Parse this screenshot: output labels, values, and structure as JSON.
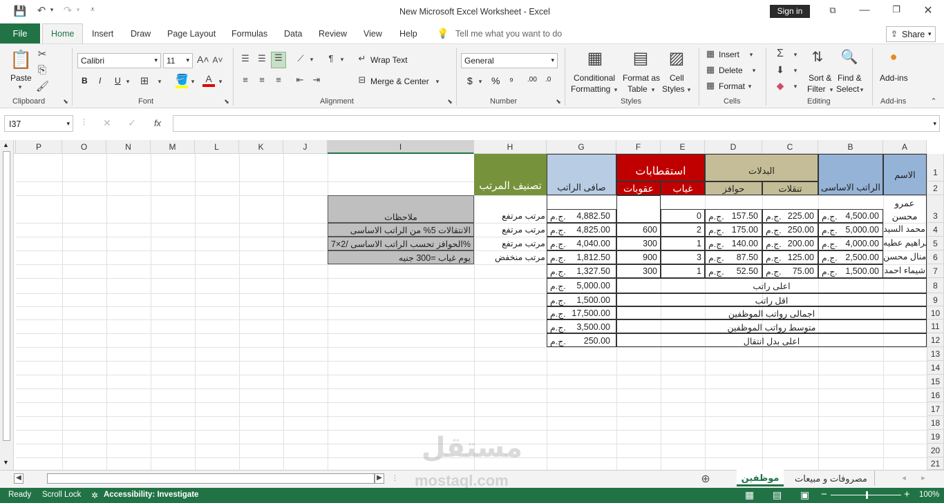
{
  "window": {
    "title": "New Microsoft Excel Worksheet  -  Excel",
    "sign_in": "Sign in"
  },
  "tabs": [
    "File",
    "Home",
    "Insert",
    "Draw",
    "Page Layout",
    "Formulas",
    "Data",
    "Review",
    "View",
    "Help"
  ],
  "tell_me": "Tell me what you want to do",
  "share": "Share",
  "ribbon": {
    "clipboard": {
      "label": "Clipboard",
      "paste": "Paste"
    },
    "font": {
      "label": "Font",
      "name": "Calibri",
      "size": "11",
      "bold": "B",
      "italic": "I",
      "underline": "U"
    },
    "alignment": {
      "label": "Alignment",
      "wrap": "Wrap Text",
      "merge": "Merge & Center"
    },
    "number": {
      "label": "Number",
      "format": "General",
      "currency": "$",
      "percent": "%",
      "comma": "⁹",
      "inc_decimal": ".00",
      "dec_decimal": ".0"
    },
    "styles": {
      "label": "Styles",
      "conditional_1": "Conditional",
      "conditional_2": "Formatting",
      "format_table_1": "Format as",
      "format_table_2": "Table",
      "cell_styles_1": "Cell",
      "cell_styles_2": "Styles"
    },
    "cells": {
      "label": "Cells",
      "insert": "Insert",
      "delete": "Delete",
      "format": "Format"
    },
    "editing": {
      "label": "Editing",
      "sort_1": "Sort &",
      "sort_2": "Filter",
      "find_1": "Find &",
      "find_2": "Select"
    },
    "addins": {
      "label": "Add-ins",
      "addins": "Add-ins"
    }
  },
  "formula_bar": {
    "name_box": "I37",
    "fx": "fx",
    "value": ""
  },
  "columns": [
    "P",
    "O",
    "N",
    "M",
    "L",
    "K",
    "J",
    "I",
    "H",
    "G",
    "F",
    "E",
    "D",
    "C",
    "B",
    "A"
  ],
  "rows": [
    "1",
    "2",
    "3",
    "4",
    "5",
    "6",
    "7",
    "8",
    "9",
    "10",
    "11",
    "12",
    "13",
    "14",
    "15",
    "16",
    "17",
    "18",
    "19",
    "20",
    "21"
  ],
  "sheet": {
    "name_header": "الاسم",
    "basic_salary": "الراتب الاساسى",
    "allowances": "البدلات",
    "transport": "تنقلات",
    "incentives": "حوافز",
    "deductions": "استقطابات",
    "absence": "غياب",
    "penalties": "عقوبات",
    "net_salary": "صافى الراتب",
    "salary_class": "تصنيف المرتب",
    "notes": "ملاحظات",
    "note_1": "الانتقالات 5% من الراتب الاساسى",
    "note_2": "الحوافز تحسب الراتب الاساسى /2×7%",
    "note_3": "يوم غياب =300 جنيه",
    "employees": [
      {
        "name": "عمرو محسن",
        "basic": "4,500.00",
        "transport": "225.00",
        "incentives": "157.50",
        "absence": "0",
        "penalty": "",
        "net": "4,882.50",
        "class": "مرتب مرتفع"
      },
      {
        "name": "محمد السيد",
        "basic": "5,000.00",
        "transport": "250.00",
        "incentives": "175.00",
        "absence": "2",
        "penalty": "600",
        "net": "4,825.00",
        "class": "مرتب مرتفع"
      },
      {
        "name": "ابراهيم عطيه",
        "basic": "4,000.00",
        "transport": "200.00",
        "incentives": "140.00",
        "absence": "1",
        "penalty": "300",
        "net": "4,040.00",
        "class": "مرتب مرتفع"
      },
      {
        "name": "منال محسن",
        "basic": "2,500.00",
        "transport": "125.00",
        "incentives": "87.50",
        "absence": "3",
        "penalty": "900",
        "net": "1,812.50",
        "class": "مرتب منخفض"
      },
      {
        "name": "شيماء احمد",
        "basic": "1,500.00",
        "transport": "75.00",
        "incentives": "52.50",
        "absence": "1",
        "penalty": "300",
        "net": "1,327.50",
        "class": ""
      }
    ],
    "currency": "ج.م.",
    "summary": [
      {
        "label": "اعلى راتب",
        "value": "5,000.00"
      },
      {
        "label": "اقل راتب",
        "value": "1,500.00"
      },
      {
        "label": "اجمالى رواتب الموظفين",
        "value": "17,500.00"
      },
      {
        "label": "متوسط رواتب الموظفين",
        "value": "3,500.00"
      },
      {
        "label": "اعلى بدل انتقال",
        "value": "250.00"
      }
    ]
  },
  "sheet_tabs": {
    "active": "موظفين",
    "other": "مصروفات و مبيعات"
  },
  "watermark": {
    "ar": "مستقل",
    "en": "mostaql.com"
  },
  "status": {
    "ready": "Ready",
    "scroll_lock": "Scroll Lock",
    "accessibility": "Accessibility: Investigate",
    "zoom": "100%"
  },
  "colors": {
    "excel_green": "#217346",
    "olive": "#76933c",
    "blue_header": "#95b3d7",
    "light_blue": "#b8cce4",
    "red": "#c00000",
    "tan": "#c4bd97",
    "grey": "#bfbfbf"
  }
}
